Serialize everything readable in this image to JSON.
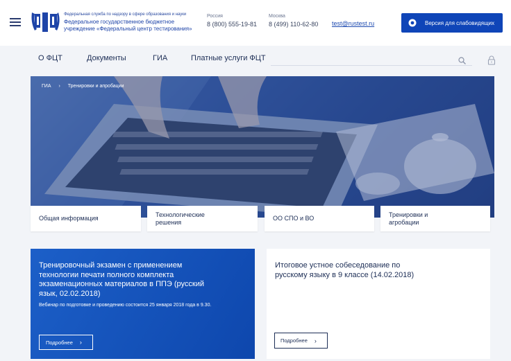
{
  "header": {
    "org_small": "Федеральная служба по надзору в сфере образования и науки",
    "org_name_line1": "Федеральное государственное бюджетное",
    "org_name_line2": "учреждение «Федеральный центр тестирования»",
    "contacts": [
      {
        "city": "Россия",
        "phone": "8 (800) 555-19-81"
      },
      {
        "city": "Москва",
        "phone": "8 (499) 110-62-80"
      }
    ],
    "email": "test@rustest.ru",
    "vision_button": "Версия для слабовидящих"
  },
  "nav": {
    "items": [
      "О ФЦТ",
      "Документы",
      "ГИА",
      "Платные услуги ФЦТ"
    ]
  },
  "breadcrumb": {
    "root": "ГИА",
    "separator": "›",
    "current": "Тренировки и апробации"
  },
  "tiles": [
    "Общая информация",
    "Технологические решения",
    "ОО СПО и ВО",
    "Тренировки и агробации"
  ],
  "cards": [
    {
      "title": "Тренировочный экзамен с применением технологии печати полного комплекта экзаменационных материалов в ППЭ (русский язык, 02.02.2018)",
      "desc": "Вебинар по подготовке и проведению состоится 25 января 2018 года в 9.30.",
      "button": "Подробнее"
    },
    {
      "title": "Итоговое устное собеседование по русскому языку в 9 классе (14.02.2018)",
      "button": "Подробнее"
    }
  ],
  "colors": {
    "brand_blue": "#0f45b8",
    "text_dark": "#1c2d55",
    "background": "#f2f4f8"
  }
}
